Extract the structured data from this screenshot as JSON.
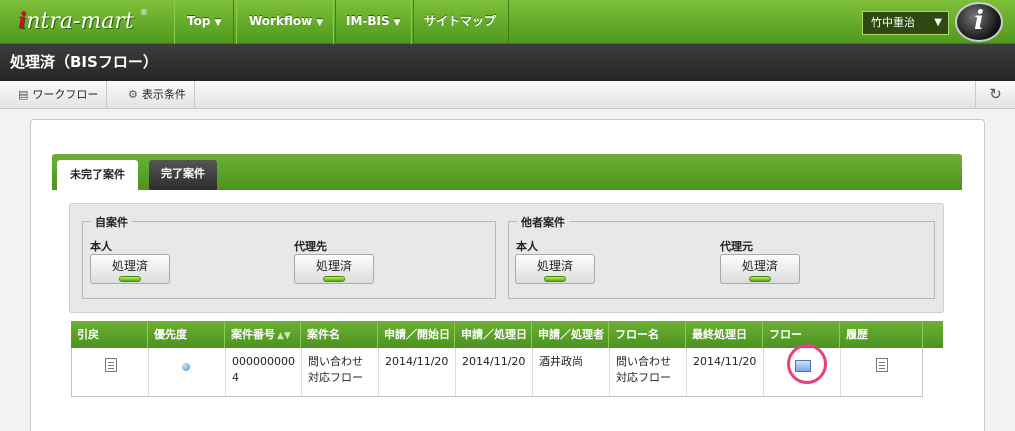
{
  "app": {
    "brand": "intra-mart",
    "brand_i": "i",
    "brand_rest": "ntra-mart",
    "reg": "®",
    "avatar_letter": "i"
  },
  "nav": {
    "items": [
      {
        "label": "Top",
        "caret": "▼"
      },
      {
        "label": "Workflow",
        "caret": "▼"
      },
      {
        "label": "IM-BIS",
        "caret": "▼"
      },
      {
        "label": "サイトマップ",
        "caret": ""
      }
    ],
    "user": "竹中重治",
    "user_caret": "▼"
  },
  "page": {
    "title": "処理済（BISフロー）"
  },
  "toolbar": {
    "workflow_label": "ワークフロー",
    "conditions_label": "表示条件",
    "refresh_glyph": "↻"
  },
  "tabs": [
    {
      "label": "未完了案件",
      "active": true
    },
    {
      "label": "完了案件",
      "active": false
    }
  ],
  "filters": {
    "own": {
      "legend": "自案件",
      "groups": [
        {
          "label": "本人",
          "button": "処理済"
        },
        {
          "label": "代理先",
          "button": "処理済"
        }
      ]
    },
    "others": {
      "legend": "他者案件",
      "groups": [
        {
          "label": "本人",
          "button": "処理済"
        },
        {
          "label": "代理元",
          "button": "処理済"
        }
      ]
    }
  },
  "table": {
    "columns": [
      "引戻",
      "優先度",
      "案件番号",
      "案件名",
      "申請／開始日",
      "申請／処理日",
      "申請／処理者",
      "フロー名",
      "最終処理日",
      "フロー",
      "履歴"
    ],
    "sort_glyph": "▲▼",
    "rows": [
      {
        "case_no_line1": "000000000",
        "case_no_line2": "4",
        "case_name_line1": "問い合わせ",
        "case_name_line2": "対応フロー",
        "start_date": "2014/11/20",
        "process_date": "2014/11/20",
        "processor": "酒井政尚",
        "flow_name_line1": "問い合わせ",
        "flow_name_line2": "対応フロー",
        "last_date": "2014/11/20"
      }
    ]
  },
  "colors": {
    "accent_green": "#4f9a1e",
    "title_dark": "#2c2c2c",
    "highlight_ring": "#e8407a"
  }
}
